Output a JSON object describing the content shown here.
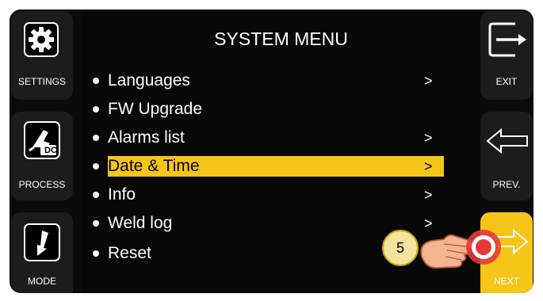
{
  "menu_title": "SYSTEM MENU",
  "left_buttons": [
    {
      "label": "SETTINGS",
      "icon": "gear-icon"
    },
    {
      "label": "PROCESS",
      "icon": "welding-torch-dc-icon",
      "badge": "DC"
    },
    {
      "label": "MODE",
      "icon": "torch-mode-icon"
    }
  ],
  "right_buttons": [
    {
      "label": "EXIT",
      "icon": "exit-arrow-icon"
    },
    {
      "label": "PREV.",
      "icon": "arrow-left-outline-icon"
    },
    {
      "label": "NEXT",
      "icon": "arrow-right-outline-icon"
    }
  ],
  "menu_items": [
    {
      "label": "Languages",
      "arrow": ">"
    },
    {
      "label": "FW Upgrade",
      "arrow": ""
    },
    {
      "label": "Alarms list",
      "arrow": ">"
    },
    {
      "label": "Date & Time",
      "arrow": ">",
      "selected": true
    },
    {
      "label": "Info",
      "arrow": ">"
    },
    {
      "label": "Weld log",
      "arrow": ">"
    },
    {
      "label": "Reset",
      "arrow": ""
    }
  ],
  "step_callout": "5",
  "colors": {
    "highlight": "#f5c518",
    "next_button_active": "#f5c518",
    "panel": "#1c1c1c",
    "background": "#0b0b0b",
    "tap_target": "#e63a3a"
  }
}
